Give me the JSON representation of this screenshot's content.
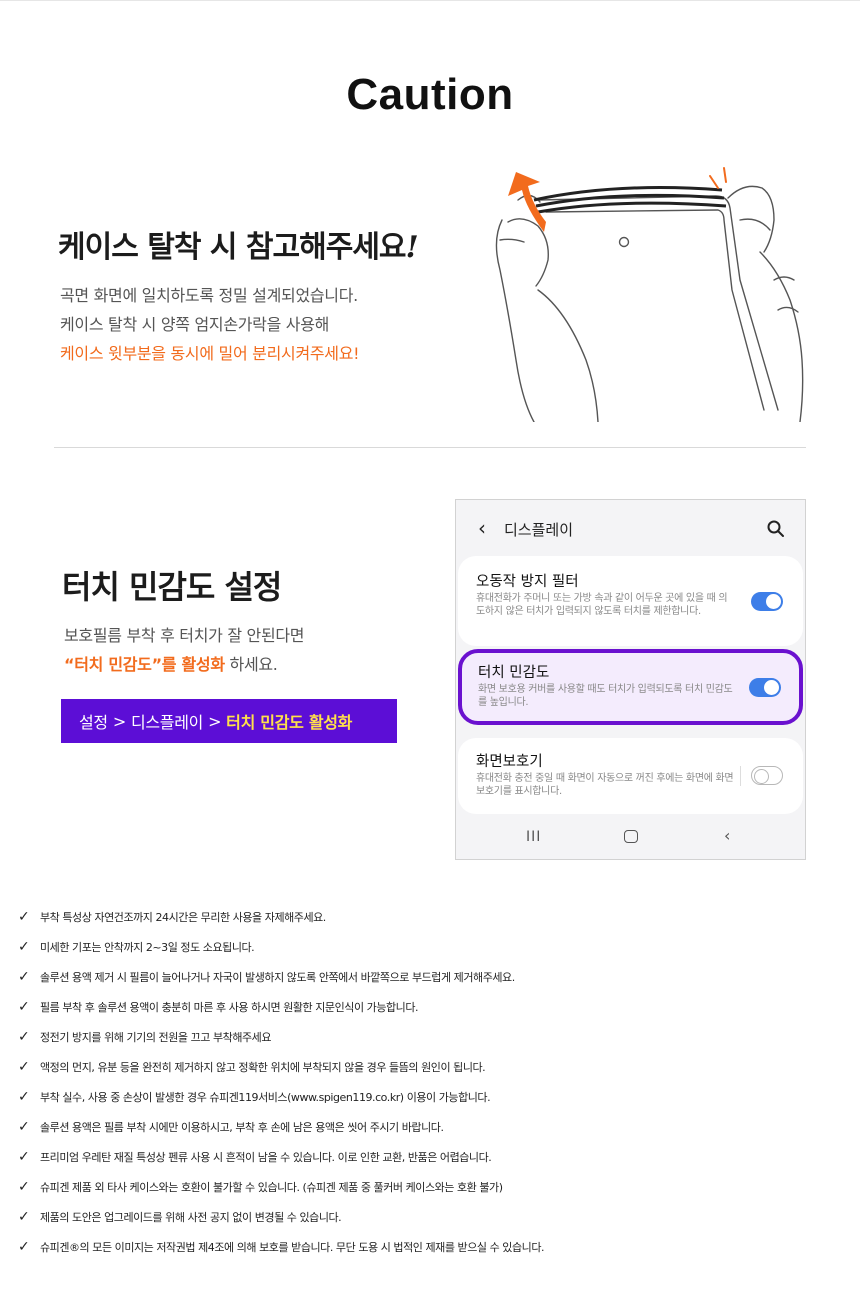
{
  "title": "Caution",
  "section1": {
    "heading": "케이스 탈착 시 참고해주세요",
    "heading_mark": "!",
    "lines": [
      "곡면 화면에 일치하도록 정밀 설계되었습니다.",
      "케이스 탈착 시 양쪽 엄지손가락을 사용해",
      "케이스 윗부분을 동시에 밀어 분리시켜주세요!"
    ]
  },
  "section2": {
    "heading": "터치 민감도 설정",
    "line1": "보호필름 부착 후 터치가 잘 안된다면",
    "line2_highlight": "“터치 민감도”를 활성화",
    "line2_rest": " 하세요.",
    "path": {
      "settings": "설정",
      "separator": ">",
      "display": "디스플레이",
      "highlight": "터치 민감도 활성화"
    }
  },
  "phone": {
    "back_icon": "chevron-left-icon",
    "title": "디스플레이",
    "search_icon": "search-icon",
    "items": [
      {
        "title": "오동작 방지 필터",
        "description": "휴대전화가 주머니 또는 가방 속과 같이 어두운 곳에 있을 때 의도하지 않은 터치가 입력되지 않도록 터치를 제한합니다.",
        "enabled": true
      },
      {
        "title": "터치 민감도",
        "description": "화면 보호용 커버를 사용할 때도 터치가 입력되도록 터치 민감도를 높입니다.",
        "enabled": true
      },
      {
        "title": "화면보호기",
        "description": "휴대전화 충전 중일 때 화면이 자동으로 꺼진 후에는 화면에 화면보호기를 표시합니다.",
        "enabled": false
      }
    ],
    "nav": {
      "recent": "III",
      "home_icon": "home-icon",
      "back": "‹"
    }
  },
  "colors": {
    "accent_orange": "#f26b1d",
    "path_bar_bg": "#5c0ed6",
    "path_highlight": "#ffe14a",
    "phone_highlight_border": "#6a11cf",
    "toggle_on": "#3d7ee8"
  },
  "check_mark": "✓",
  "cautions": [
    "부착 특성상 자연건조까지 24시간은 무리한 사용을 자제해주세요.",
    "미세한 기포는 안착까지 2~3일 정도 소요됩니다.",
    "솔루션 용액 제거 시 필름이 늘어나거나 자국이 발생하지 않도록 안쪽에서 바깥쪽으로 부드럽게 제거해주세요.",
    "필름 부착 후 솔루션 용액이 충분히 마른 후 사용 하시면 원활한 지문인식이 가능합니다.",
    "정전기 방지를 위해 기기의 전원을 끄고 부착해주세요",
    "액정의 먼지, 유분 등을 완전히 제거하지 않고 정확한 위치에 부착되지 않을 경우 들뜸의 원인이 됩니다.",
    "부착 실수, 사용 중 손상이 발생한 경우 슈피겐119서비스(www.spigen119.co.kr) 이용이 가능합니다.",
    "솔루션 용액은 필름 부착 시에만 이용하시고, 부착 후 손에 남은 용액은 씻어 주시기 바랍니다.",
    "프리미엄 우레탄 재질 특성상 펜류 사용 시 흔적이 남을 수 있습니다. 이로 인한 교환, 반품은 어렵습니다.",
    "슈피겐 제품 외 타사 케이스와는 호환이 불가할 수 있습니다. (슈피겐 제품 중 풀커버 케이스와는 호환 불가)",
    "제품의 도안은 업그레이드를 위해 사전 공지 없이 변경될 수 있습니다.",
    "슈피겐®의 모든 이미지는 저작권법 제4조에 의해 보호를 받습니다. 무단 도용 시 법적인 제재를 받으실 수 있습니다."
  ]
}
